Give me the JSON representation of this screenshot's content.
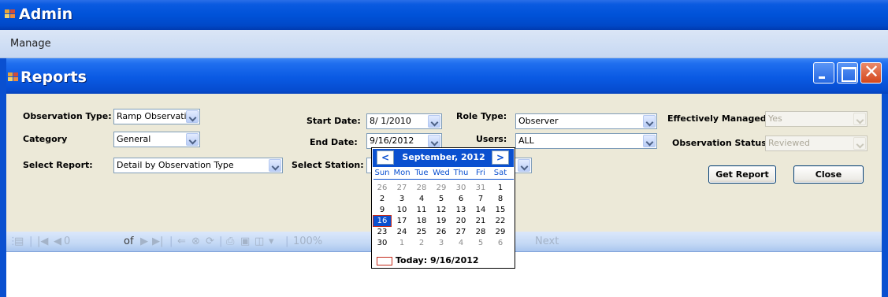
{
  "admin_window": {
    "title": "Admin",
    "icon": "app-icon"
  },
  "menu": {
    "items": [
      "Manage"
    ]
  },
  "reports_window": {
    "title": "Reports",
    "icon": "app-icon",
    "controls": [
      "minimize-icon",
      "maximize-icon",
      "close-icon"
    ]
  },
  "form": {
    "observation_type": {
      "label": "Observation Type:",
      "value": "Ramp Observation"
    },
    "category": {
      "label": "Category",
      "value": "General"
    },
    "select_report": {
      "label": "Select Report:",
      "value": "Detail by Observation Type"
    },
    "start_date": {
      "label": "Start Date:",
      "value": "8/ 1/2010"
    },
    "end_date": {
      "label": "End Date:",
      "value": "9/16/2012"
    },
    "select_station": {
      "label": "Select Station:",
      "value": ""
    },
    "role_type": {
      "label": "Role Type:",
      "value": "Observer"
    },
    "users": {
      "label": "Users:",
      "value": "ALL"
    },
    "effectively_managed": {
      "label": "Effectively Managed:",
      "value": "Yes",
      "disabled": true
    },
    "observation_status": {
      "label": "Observation Status:",
      "value": "Reviewed",
      "disabled": true
    },
    "get_report_button": "Get Report",
    "close_button": "Close"
  },
  "toolbar": {
    "page_value": "0",
    "of_label": "of",
    "zoom": "100%",
    "next_label": "Next"
  },
  "calendar": {
    "month_title": "September, 2012",
    "prev_symbol": "<",
    "next_symbol": ">",
    "weekdays": [
      "Sun",
      "Mon",
      "Tue",
      "Wed",
      "Thu",
      "Fri",
      "Sat"
    ],
    "weeks": [
      [
        "26",
        "27",
        "28",
        "29",
        "30",
        "31",
        "1"
      ],
      [
        "2",
        "3",
        "4",
        "5",
        "6",
        "7",
        "8"
      ],
      [
        "9",
        "10",
        "11",
        "12",
        "13",
        "14",
        "15"
      ],
      [
        "16",
        "17",
        "18",
        "19",
        "20",
        "21",
        "22"
      ],
      [
        "23",
        "24",
        "25",
        "26",
        "27",
        "28",
        "29"
      ],
      [
        "30",
        "1",
        "2",
        "3",
        "4",
        "5",
        "6"
      ]
    ],
    "selected": "16",
    "today_label": "Today: 9/16/2012"
  },
  "colors": {
    "title_blue": "#0a50d0",
    "selection_outline": "#c42b1c"
  }
}
